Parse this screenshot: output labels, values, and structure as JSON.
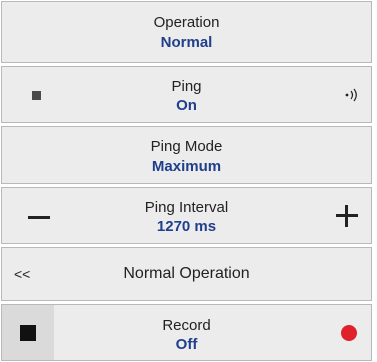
{
  "rows": {
    "operation": {
      "label": "Operation",
      "value": "Normal"
    },
    "ping": {
      "label": "Ping",
      "value": "On"
    },
    "ping_mode": {
      "label": "Ping Mode",
      "value": "Maximum"
    },
    "ping_interval": {
      "label": "Ping Interval",
      "value": "1270 ms"
    },
    "normal_operation": {
      "back_label": "<<",
      "label": "Normal Operation"
    },
    "record": {
      "label": "Record",
      "value": "Off"
    }
  },
  "icons": {
    "ping_left": "stop-square-icon",
    "ping_right": "ping-wave-icon",
    "interval_decrease": "minus-icon",
    "interval_increase": "plus-icon",
    "record_left": "stop-square-icon",
    "record_right": "record-dot-icon"
  },
  "colors": {
    "value_text": "#1f3f8c",
    "row_bg": "#ececec",
    "row_border": "#b9b9b9",
    "record_red": "#e0202a"
  }
}
